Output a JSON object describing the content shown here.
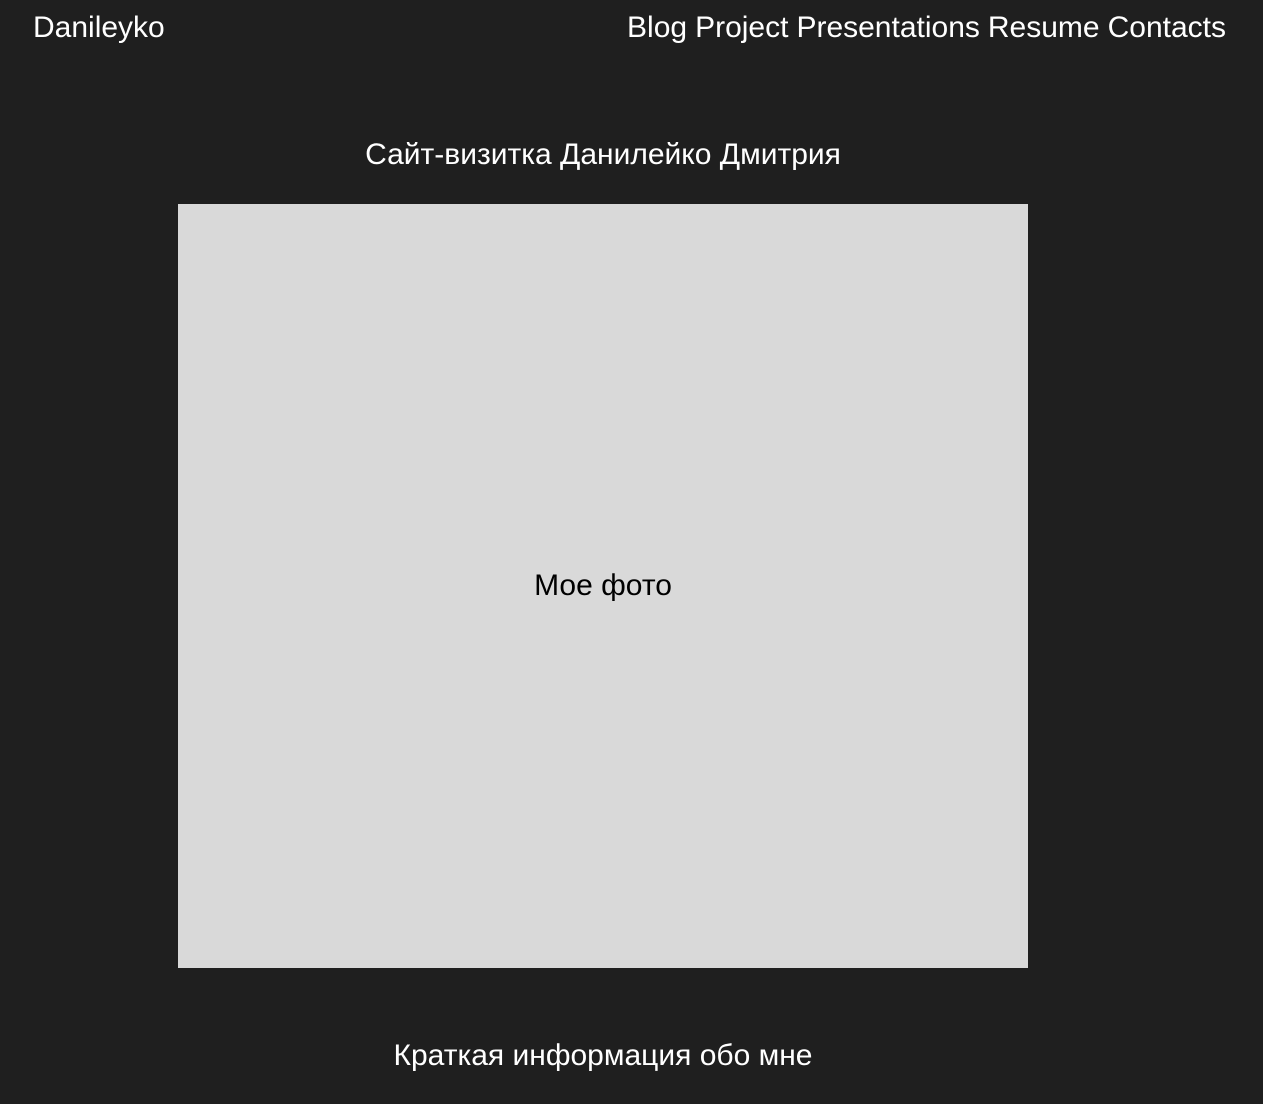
{
  "header": {
    "logo": "Danileyko",
    "nav": [
      {
        "label": "Blog"
      },
      {
        "label": "Project"
      },
      {
        "label": "Presentations"
      },
      {
        "label": "Resume"
      },
      {
        "label": "Contacts"
      }
    ]
  },
  "main": {
    "title": "Сайт-визитка Данилейко Дмитрия",
    "photo_placeholder": "Мое фото",
    "about_heading": "Краткая информация обо мне"
  },
  "colors": {
    "background": "#1f1f1f",
    "photo_placeholder_bg": "#d9d9d9",
    "text_light": "#ffffff",
    "text_dark": "#000000"
  }
}
